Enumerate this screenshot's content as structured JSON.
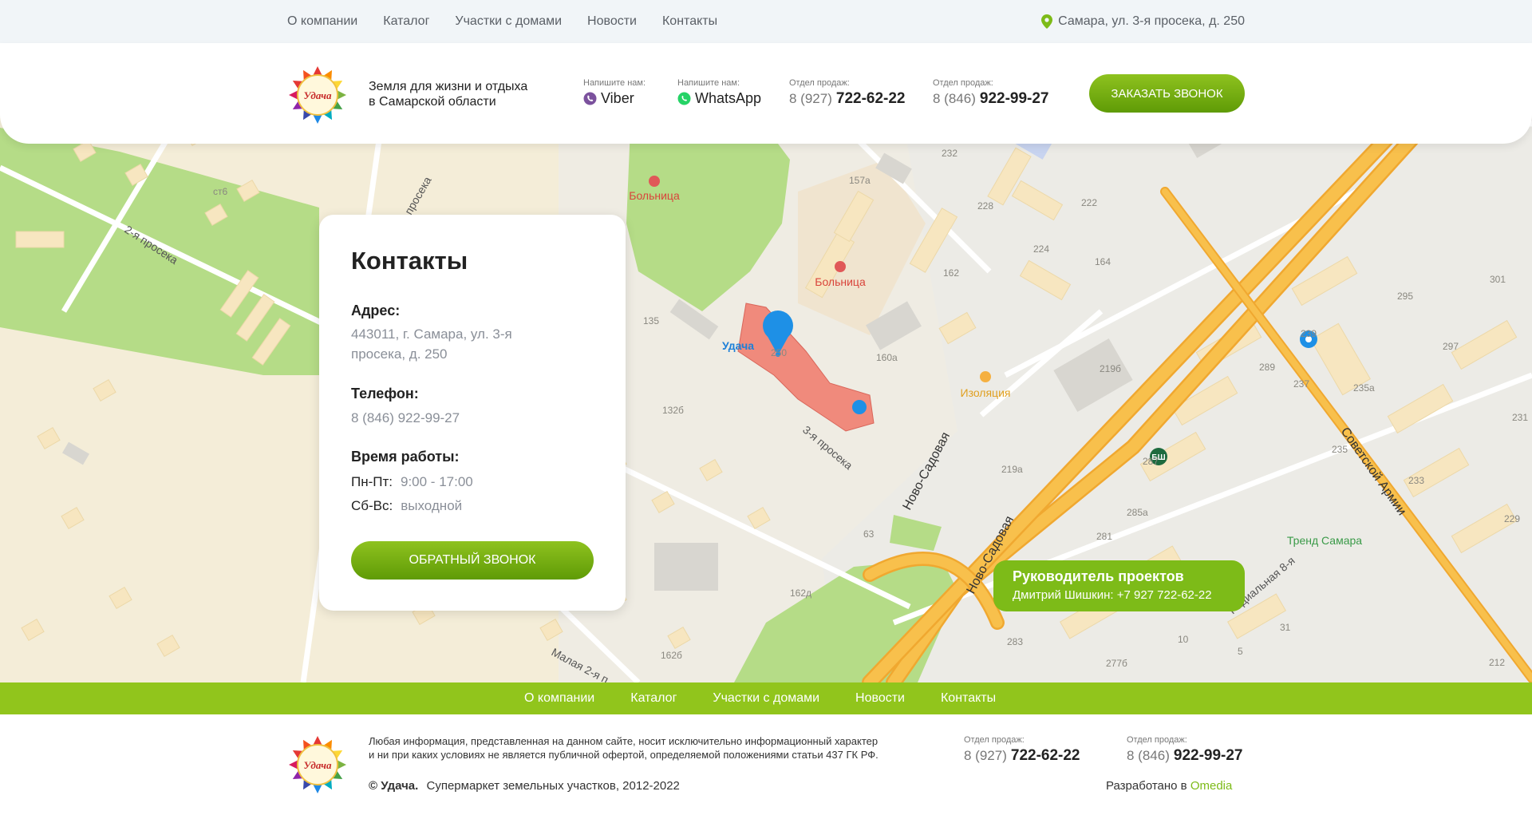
{
  "topnav": {
    "items": [
      "О компании",
      "Каталог",
      "Участки с домами",
      "Новости",
      "Контакты"
    ],
    "address": "Самара, ул. 3-я просека, д. 250"
  },
  "header": {
    "logo_text": "Удача",
    "slogan_line1": "Земля для жизни и отдыха",
    "slogan_line2": "в Самарской области",
    "viber": {
      "label": "Напишите нам:",
      "value": "Viber"
    },
    "whatsapp": {
      "label": "Напишите нам:",
      "value": "WhatsApp"
    },
    "phone1": {
      "label": "Отдел продаж:",
      "prefix": "8 (927)",
      "number": "722-62-22"
    },
    "phone2": {
      "label": "Отдел продаж:",
      "prefix": "8 (846)",
      "number": "922-99-27"
    },
    "order_call": "ЗАКАЗАТЬ ЗВОНОК"
  },
  "contacts_card": {
    "title": "Контакты",
    "address_label": "Адрес:",
    "address_line1": "443011, г. Самара, ул. 3-я",
    "address_line2": "просека, д. 250",
    "phone_label": "Телефон:",
    "phone": "8 (846) 922-99-27",
    "hours_label": "Время работы:",
    "weekdays_key": "Пн-Пт:",
    "weekdays_val": "9:00 - 17:00",
    "weekend_key": "Сб-Вс:",
    "weekend_val": "выходной",
    "callback": "ОБРАТНЫЙ ЗВОНОК"
  },
  "manager": {
    "title": "Руководитель проектов",
    "contact": "Дмитрий Шишкин: +7 927 722-62-22"
  },
  "map_labels": {
    "hospital1": "Больница",
    "hospital2": "Больница",
    "udacha": "Удача",
    "izolyatsia": "Изоляция",
    "trend": "Тренд Самара",
    "street_3": "3-я просека",
    "street_2": "2-я просека",
    "street_novosad1": "Ново-Садовая",
    "street_novosad2": "Ново-Садовая",
    "street_sov": "Советской Армии",
    "street_rad": "Радиальная 8-я",
    "street_mal": "Малая 2-я п",
    "street_pros": "просека",
    "bsh": "БШ",
    "houses": [
      "232",
      "228",
      "222",
      "224",
      "164",
      "162",
      "157а",
      "135",
      "160а",
      "219б",
      "219а",
      "287",
      "285а",
      "281",
      "283",
      "63",
      "162д",
      "162б",
      "132б",
      "239",
      "237",
      "235а",
      "235",
      "233",
      "231",
      "229",
      "295",
      "297",
      "301",
      "289",
      "10",
      "5",
      "31",
      "212",
      "277б",
      "ст6",
      "250"
    ]
  },
  "greennav": {
    "items": [
      "О компании",
      "Каталог",
      "Участки с домами",
      "Новости",
      "Контакты"
    ]
  },
  "footer": {
    "disclaimer_line1": "Любая информация, представленная на данном сайте, носит исключительно информационный характер",
    "disclaimer_line2": "и ни при каких условиях не является публичной офертой, определяемой положениями статьи 437 ГК РФ.",
    "copyright_brand": "© Удача.",
    "copyright_text": "Супермаркет земельных участков, 2012-2022",
    "phone1": {
      "label": "Отдел продаж:",
      "prefix": "8 (927)",
      "number": "722-62-22"
    },
    "phone2": {
      "label": "Отдел продаж:",
      "prefix": "8 (846)",
      "number": "922-99-27"
    },
    "dev_text": "Разработано в",
    "dev_link": "Omedia"
  },
  "colors": {
    "accent": "#7dbb18",
    "green_nav": "#91c51c",
    "road": "#f6b73c",
    "park": "#b5dc87",
    "building": "#f6e7c2"
  }
}
